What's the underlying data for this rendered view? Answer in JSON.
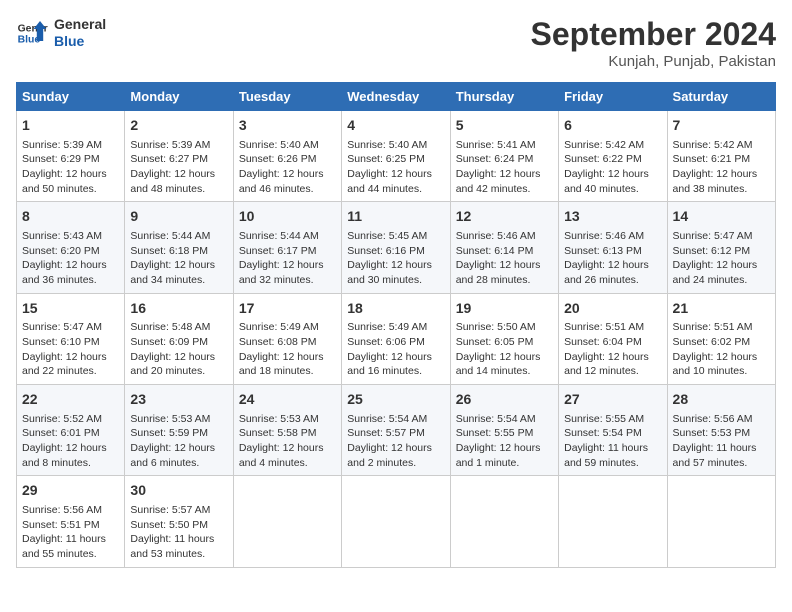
{
  "logo": {
    "line1": "General",
    "line2": "Blue"
  },
  "title": "September 2024",
  "subtitle": "Kunjah, Punjab, Pakistan",
  "days_header": [
    "Sunday",
    "Monday",
    "Tuesday",
    "Wednesday",
    "Thursday",
    "Friday",
    "Saturday"
  ],
  "weeks": [
    [
      {
        "num": "1",
        "info": "Sunrise: 5:39 AM\nSunset: 6:29 PM\nDaylight: 12 hours\nand 50 minutes."
      },
      {
        "num": "2",
        "info": "Sunrise: 5:39 AM\nSunset: 6:27 PM\nDaylight: 12 hours\nand 48 minutes."
      },
      {
        "num": "3",
        "info": "Sunrise: 5:40 AM\nSunset: 6:26 PM\nDaylight: 12 hours\nand 46 minutes."
      },
      {
        "num": "4",
        "info": "Sunrise: 5:40 AM\nSunset: 6:25 PM\nDaylight: 12 hours\nand 44 minutes."
      },
      {
        "num": "5",
        "info": "Sunrise: 5:41 AM\nSunset: 6:24 PM\nDaylight: 12 hours\nand 42 minutes."
      },
      {
        "num": "6",
        "info": "Sunrise: 5:42 AM\nSunset: 6:22 PM\nDaylight: 12 hours\nand 40 minutes."
      },
      {
        "num": "7",
        "info": "Sunrise: 5:42 AM\nSunset: 6:21 PM\nDaylight: 12 hours\nand 38 minutes."
      }
    ],
    [
      {
        "num": "8",
        "info": "Sunrise: 5:43 AM\nSunset: 6:20 PM\nDaylight: 12 hours\nand 36 minutes."
      },
      {
        "num": "9",
        "info": "Sunrise: 5:44 AM\nSunset: 6:18 PM\nDaylight: 12 hours\nand 34 minutes."
      },
      {
        "num": "10",
        "info": "Sunrise: 5:44 AM\nSunset: 6:17 PM\nDaylight: 12 hours\nand 32 minutes."
      },
      {
        "num": "11",
        "info": "Sunrise: 5:45 AM\nSunset: 6:16 PM\nDaylight: 12 hours\nand 30 minutes."
      },
      {
        "num": "12",
        "info": "Sunrise: 5:46 AM\nSunset: 6:14 PM\nDaylight: 12 hours\nand 28 minutes."
      },
      {
        "num": "13",
        "info": "Sunrise: 5:46 AM\nSunset: 6:13 PM\nDaylight: 12 hours\nand 26 minutes."
      },
      {
        "num": "14",
        "info": "Sunrise: 5:47 AM\nSunset: 6:12 PM\nDaylight: 12 hours\nand 24 minutes."
      }
    ],
    [
      {
        "num": "15",
        "info": "Sunrise: 5:47 AM\nSunset: 6:10 PM\nDaylight: 12 hours\nand 22 minutes."
      },
      {
        "num": "16",
        "info": "Sunrise: 5:48 AM\nSunset: 6:09 PM\nDaylight: 12 hours\nand 20 minutes."
      },
      {
        "num": "17",
        "info": "Sunrise: 5:49 AM\nSunset: 6:08 PM\nDaylight: 12 hours\nand 18 minutes."
      },
      {
        "num": "18",
        "info": "Sunrise: 5:49 AM\nSunset: 6:06 PM\nDaylight: 12 hours\nand 16 minutes."
      },
      {
        "num": "19",
        "info": "Sunrise: 5:50 AM\nSunset: 6:05 PM\nDaylight: 12 hours\nand 14 minutes."
      },
      {
        "num": "20",
        "info": "Sunrise: 5:51 AM\nSunset: 6:04 PM\nDaylight: 12 hours\nand 12 minutes."
      },
      {
        "num": "21",
        "info": "Sunrise: 5:51 AM\nSunset: 6:02 PM\nDaylight: 12 hours\nand 10 minutes."
      }
    ],
    [
      {
        "num": "22",
        "info": "Sunrise: 5:52 AM\nSunset: 6:01 PM\nDaylight: 12 hours\nand 8 minutes."
      },
      {
        "num": "23",
        "info": "Sunrise: 5:53 AM\nSunset: 5:59 PM\nDaylight: 12 hours\nand 6 minutes."
      },
      {
        "num": "24",
        "info": "Sunrise: 5:53 AM\nSunset: 5:58 PM\nDaylight: 12 hours\nand 4 minutes."
      },
      {
        "num": "25",
        "info": "Sunrise: 5:54 AM\nSunset: 5:57 PM\nDaylight: 12 hours\nand 2 minutes."
      },
      {
        "num": "26",
        "info": "Sunrise: 5:54 AM\nSunset: 5:55 PM\nDaylight: 12 hours\nand 1 minute."
      },
      {
        "num": "27",
        "info": "Sunrise: 5:55 AM\nSunset: 5:54 PM\nDaylight: 11 hours\nand 59 minutes."
      },
      {
        "num": "28",
        "info": "Sunrise: 5:56 AM\nSunset: 5:53 PM\nDaylight: 11 hours\nand 57 minutes."
      }
    ],
    [
      {
        "num": "29",
        "info": "Sunrise: 5:56 AM\nSunset: 5:51 PM\nDaylight: 11 hours\nand 55 minutes."
      },
      {
        "num": "30",
        "info": "Sunrise: 5:57 AM\nSunset: 5:50 PM\nDaylight: 11 hours\nand 53 minutes."
      },
      {
        "num": "",
        "info": ""
      },
      {
        "num": "",
        "info": ""
      },
      {
        "num": "",
        "info": ""
      },
      {
        "num": "",
        "info": ""
      },
      {
        "num": "",
        "info": ""
      }
    ]
  ]
}
